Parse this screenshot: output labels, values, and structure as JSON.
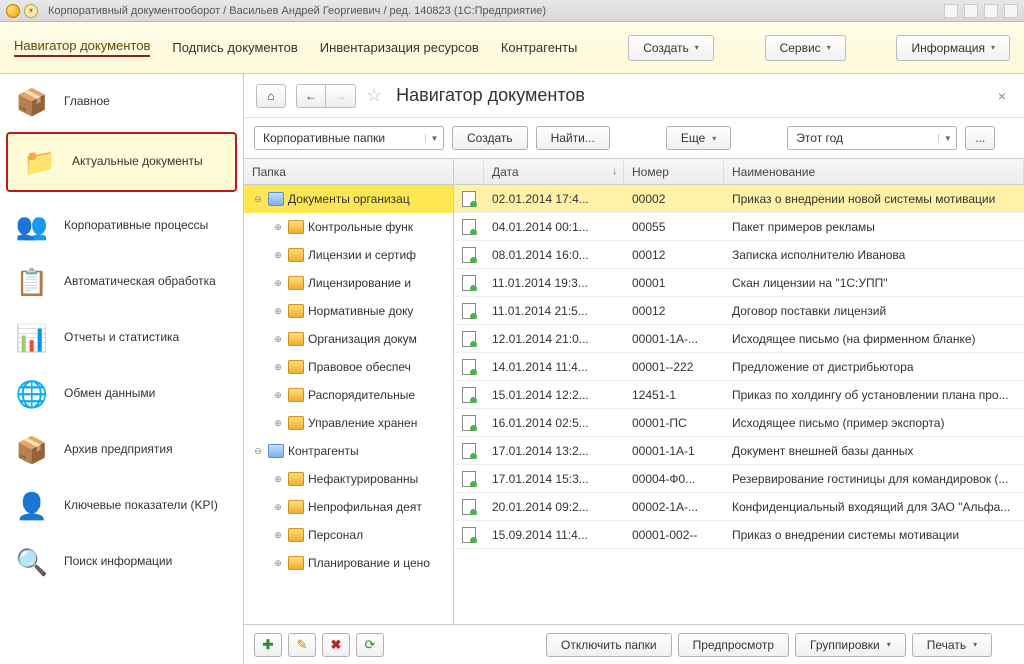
{
  "window": {
    "title": "Корпоративный документооборот / Васильев Андрей Георгиевич / ред. 140823  (1С:Предприятие)"
  },
  "menubar": {
    "links": [
      "Навигатор документов",
      "Подпись документов",
      "Инвентаризация ресурсов",
      "Контрагенты"
    ],
    "buttons": [
      "Создать",
      "Сервис",
      "Информация"
    ]
  },
  "sidebar": {
    "items": [
      {
        "label": "Главное",
        "icon": "📦"
      },
      {
        "label": "Актуальные документы",
        "icon": "📁",
        "selected": true
      },
      {
        "label": "Корпоративные процессы",
        "icon": "👥"
      },
      {
        "label": "Автоматическая обработка",
        "icon": "📋"
      },
      {
        "label": "Отчеты и статистика",
        "icon": "📊"
      },
      {
        "label": "Обмен данными",
        "icon": "🌐"
      },
      {
        "label": "Архив предприятия",
        "icon": "📦"
      },
      {
        "label": "Ключевые показатели (KPI)",
        "icon": "👤"
      },
      {
        "label": "Поиск информации",
        "icon": "🔍"
      }
    ]
  },
  "page": {
    "title": "Навигатор документов"
  },
  "toolbar": {
    "folder_select": "Корпоративные папки",
    "create": "Создать",
    "find": "Найти...",
    "more": "Еще",
    "year": "Этот год"
  },
  "tree": {
    "header": "Папка",
    "rows": [
      {
        "label": "Документы организац",
        "depth": 0,
        "exp": "⊖",
        "selected": true,
        "blue": true
      },
      {
        "label": "Контрольные функ",
        "depth": 1,
        "exp": "⊕"
      },
      {
        "label": "Лицензии и сертиф",
        "depth": 1,
        "exp": "⊕"
      },
      {
        "label": "Лицензирование и",
        "depth": 1,
        "exp": "⊕"
      },
      {
        "label": "Нормативные докy",
        "depth": 1,
        "exp": "⊕"
      },
      {
        "label": "Организация докyм",
        "depth": 1,
        "exp": "⊕"
      },
      {
        "label": "Правовое обеспеч",
        "depth": 1,
        "exp": "⊕"
      },
      {
        "label": "Распорядительные",
        "depth": 1,
        "exp": "⊕"
      },
      {
        "label": "Управление хранен",
        "depth": 1,
        "exp": "⊕"
      },
      {
        "label": "Контрагенты",
        "depth": 0,
        "exp": "⊖",
        "blue": true
      },
      {
        "label": "Нефактурированны",
        "depth": 1,
        "exp": "⊕"
      },
      {
        "label": "Непрофильная деят",
        "depth": 1,
        "exp": "⊕"
      },
      {
        "label": "Персонал",
        "depth": 1,
        "exp": "⊕"
      },
      {
        "label": "Планирование и ценo",
        "depth": 1,
        "exp": "⊕"
      }
    ]
  },
  "grid": {
    "headers": {
      "date": "Дата",
      "number": "Номер",
      "name": "Наименование"
    },
    "rows": [
      {
        "date": "02.01.2014 17:4...",
        "num": "00002",
        "name": "Приказ о внедрении новой системы мотивации",
        "selected": true
      },
      {
        "date": "04.01.2014 00:1...",
        "num": "00055",
        "name": "Пакет примеров рекламы"
      },
      {
        "date": "08.01.2014 16:0...",
        "num": "00012",
        "name": "Записка исполнителю Иванова"
      },
      {
        "date": "11.01.2014 19:3...",
        "num": "00001",
        "name": "Скан лицензии на \"1С:УПП\""
      },
      {
        "date": "11.01.2014 21:5...",
        "num": "00012",
        "name": "Договор поставки лицензий"
      },
      {
        "date": "12.01.2014 21:0...",
        "num": "00001-1А-...",
        "name": "Исходящее письмо (на фирменном бланке)"
      },
      {
        "date": "14.01.2014 11:4...",
        "num": "00001--222",
        "name": "Предложение от дистрибьютора"
      },
      {
        "date": "15.01.2014 12:2...",
        "num": "12451-1",
        "name": "Приказ по холдингу об установлении плана про..."
      },
      {
        "date": "16.01.2014 02:5...",
        "num": "00001-ПС",
        "name": "Исходящее письмо (пример экспорта)"
      },
      {
        "date": "17.01.2014 13:2...",
        "num": "00001-1А-1",
        "name": "Документ внешней базы данных"
      },
      {
        "date": "17.01.2014 15:3...",
        "num": "00004-Ф0...",
        "name": "Резервирование гостиницы для командировок (..."
      },
      {
        "date": "20.01.2014 09:2...",
        "num": "00002-1А-...",
        "name": "Конфиденциальный входящий для ЗАО \"Альфа..."
      },
      {
        "date": "15.09.2014 11:4...",
        "num": "00001-002--",
        "name": "Приказ о внедрении системы мотивации"
      }
    ]
  },
  "bottom": {
    "disable_folders": "Отключить папки",
    "preview": "Предпросмотр",
    "grouping": "Группировки",
    "print": "Печать"
  }
}
